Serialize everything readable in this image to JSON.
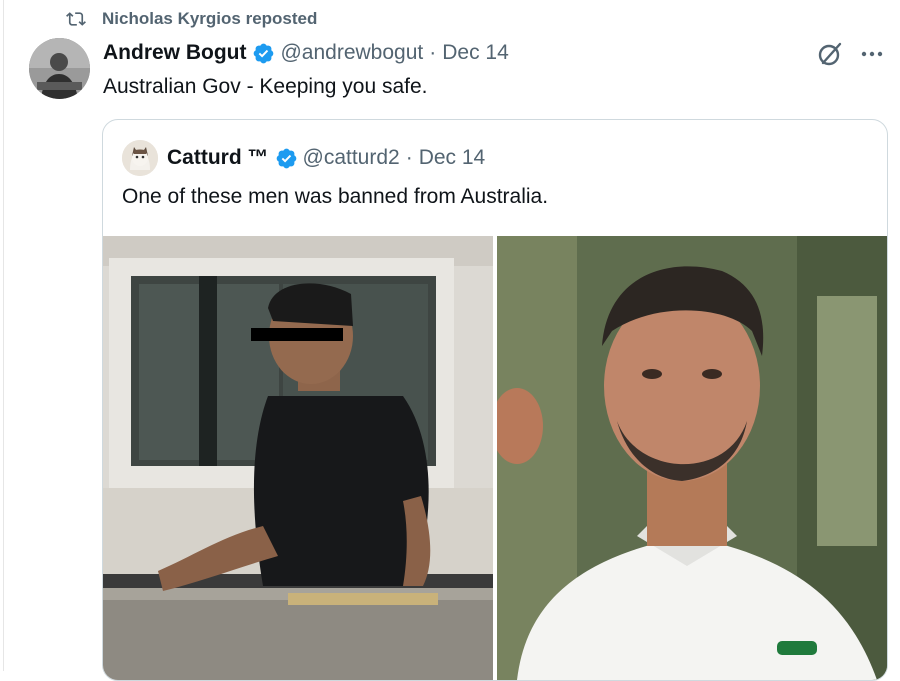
{
  "repost": {
    "label": "Nicholas Kyrgios reposted",
    "icon": "repost-icon"
  },
  "tweet": {
    "author_name": "Andrew Bogut",
    "handle": "@andrewbogut",
    "separator": "·",
    "date": "Dec 14",
    "text": "Australian Gov - Keeping you safe.",
    "verified_icon": "verified-badge-icon",
    "actions": [
      "grok-icon",
      "more-icon"
    ]
  },
  "quote": {
    "author_name": "Catturd ™",
    "handle": "@catturd2",
    "separator": "·",
    "date": "Dec 14",
    "text": "One of these men was banned from Australia.",
    "verified_icon": "verified-badge-icon",
    "media": [
      "photo-man-on-balcony",
      "photo-tennis-player"
    ]
  },
  "colors": {
    "text": "#0f1419",
    "secondary": "#536471",
    "verified": "#1d9bf0",
    "border": "#cfd9de"
  }
}
